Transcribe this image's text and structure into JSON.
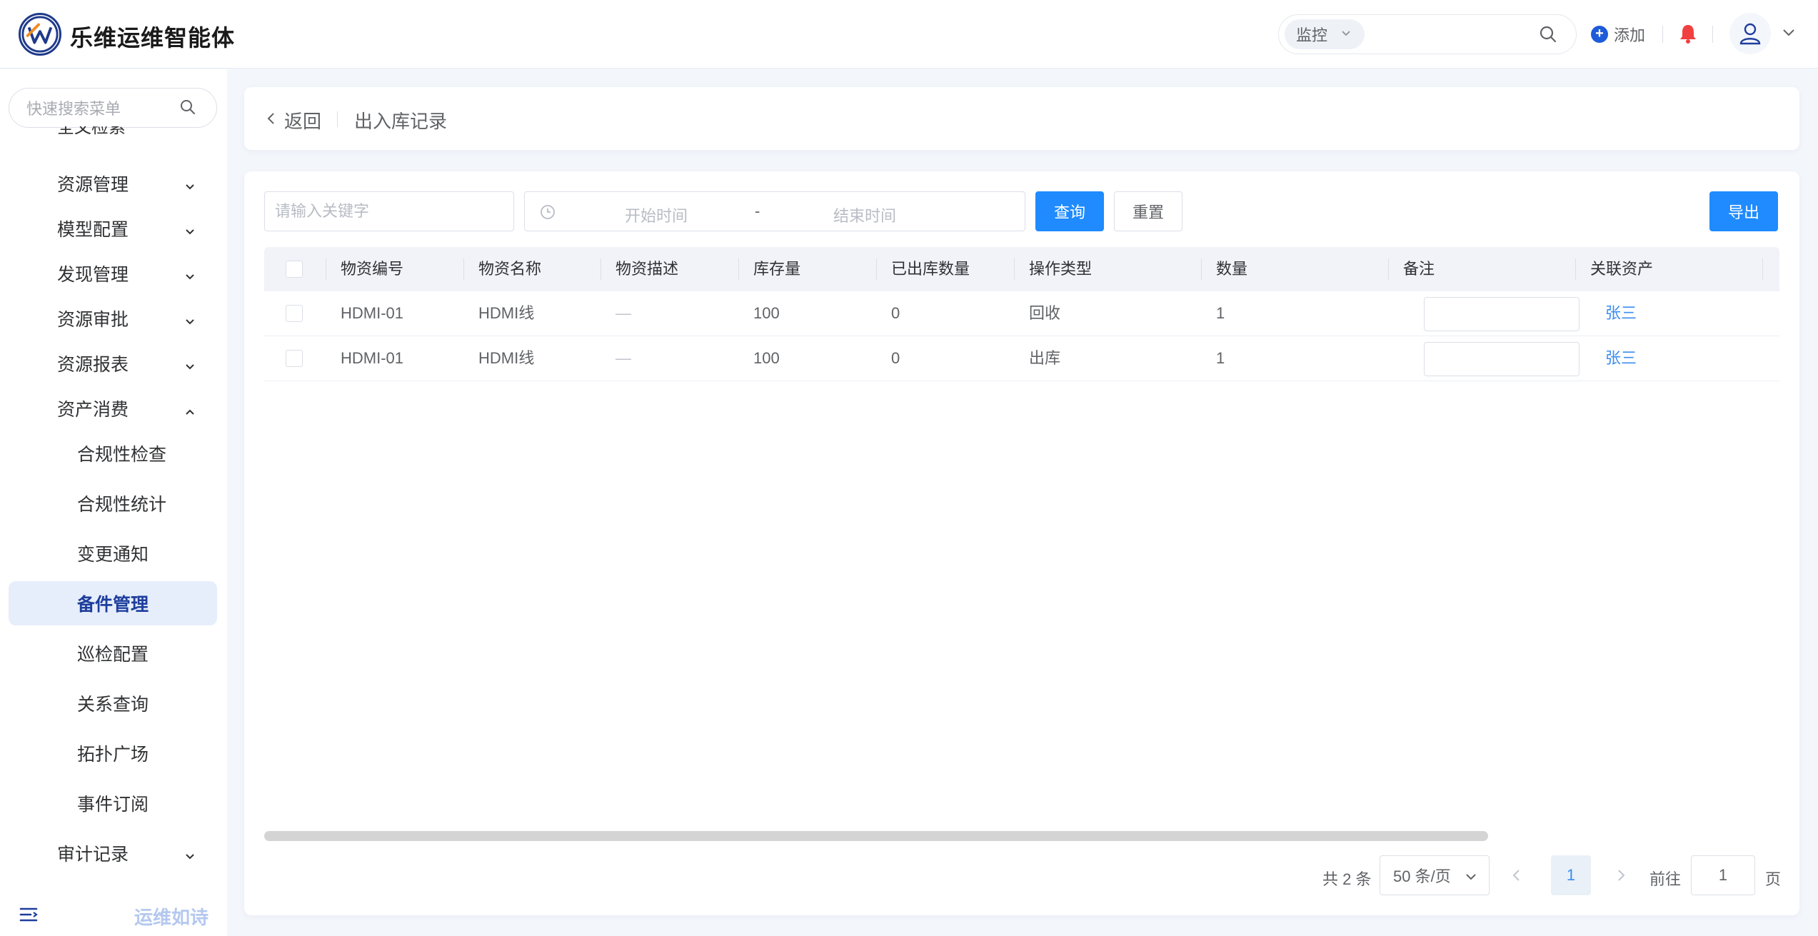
{
  "app": {
    "title": "乐维运维智能体",
    "logo_letter": "W"
  },
  "header": {
    "search_scope": "监控",
    "search_placeholder": "",
    "add_label": "添加",
    "icons": [
      "search-icon",
      "plus-circle-icon",
      "bell-icon",
      "user-icon",
      "chevron-down-icon"
    ]
  },
  "sidebar": {
    "search_placeholder": "快速搜索菜单",
    "cut_item": "全文检索",
    "items": [
      {
        "label": "资源管理",
        "expanded": false
      },
      {
        "label": "模型配置",
        "expanded": false
      },
      {
        "label": "发现管理",
        "expanded": false
      },
      {
        "label": "资源审批",
        "expanded": false
      },
      {
        "label": "资源报表",
        "expanded": false
      },
      {
        "label": "资产消费",
        "expanded": true
      }
    ],
    "subitems": [
      {
        "label": "合规性检查"
      },
      {
        "label": "合规性统计"
      },
      {
        "label": "变更通知"
      },
      {
        "label": "备件管理",
        "active": true
      },
      {
        "label": "巡检配置"
      },
      {
        "label": "关系查询"
      },
      {
        "label": "拓扑广场"
      },
      {
        "label": "事件订阅"
      }
    ],
    "last_item": "审计记录",
    "footer_text": "运维如诗"
  },
  "breadcrumb": {
    "back_label": "返回",
    "title": "出入库记录"
  },
  "filters": {
    "keyword_placeholder": "请输入关键字",
    "start_placeholder": "开始时间",
    "range_separator": "-",
    "end_placeholder": "结束时间",
    "query_label": "查询",
    "reset_label": "重置",
    "export_label": "导出"
  },
  "table": {
    "columns": [
      "物资编号",
      "物资名称",
      "物资描述",
      "库存量",
      "已出库数量",
      "操作类型",
      "数量",
      "备注",
      "关联资产"
    ],
    "rows": [
      {
        "code": "HDMI-01",
        "name": "HDMI线",
        "desc": "—",
        "stock": "100",
        "out": "0",
        "op": "回收",
        "qty": "1",
        "note": "",
        "asset": "张三"
      },
      {
        "code": "HDMI-01",
        "name": "HDMI线",
        "desc": "—",
        "stock": "100",
        "out": "0",
        "op": "出库",
        "qty": "1",
        "note": "",
        "asset": "张三"
      }
    ]
  },
  "pagination": {
    "total": "共 2 条",
    "page_size": "50 条/页",
    "current": "1",
    "goto_label": "前往",
    "goto_value": "1",
    "page_unit": "页"
  },
  "colors": {
    "primary": "#1f8bff",
    "brand_dark": "#1e3e9c",
    "link": "#3c8cf0",
    "bell": "#f04040"
  }
}
